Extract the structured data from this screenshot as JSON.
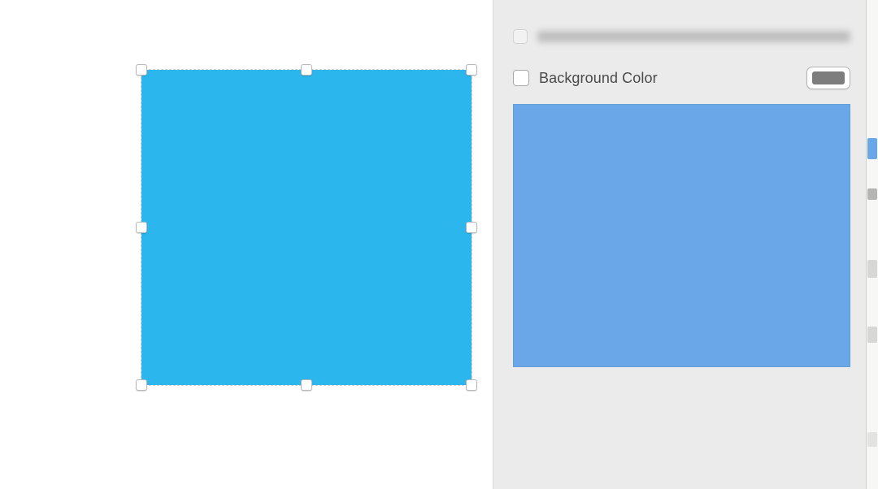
{
  "canvas": {
    "shape_fill": "#2bb6ed"
  },
  "inspector": {
    "background_color_label": "Background Color",
    "background_color_swatch": "#7d7d7d",
    "preview_fill": "#6aa7e8"
  }
}
